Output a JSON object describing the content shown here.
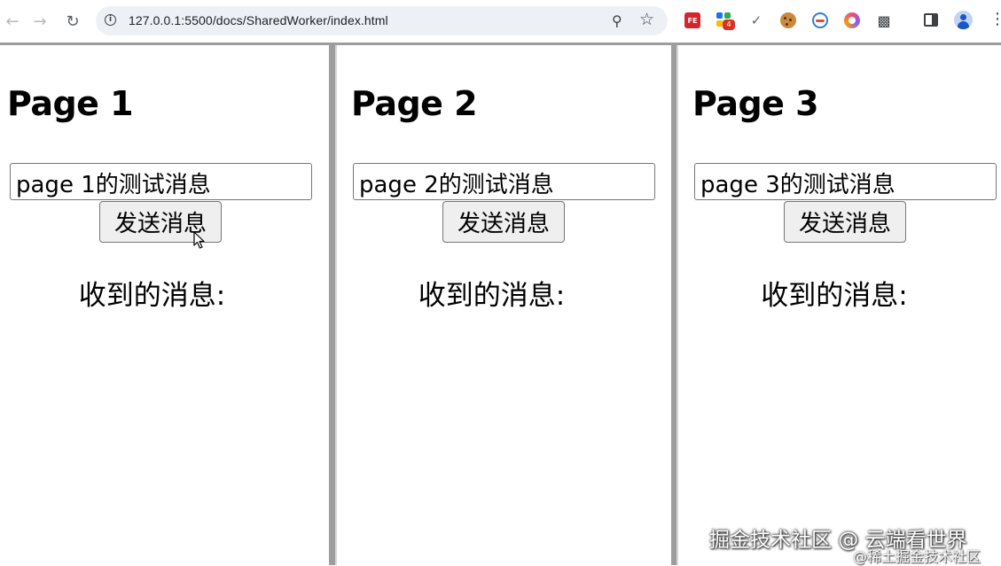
{
  "browser": {
    "url": "127.0.0.1:5500/docs/SharedWorker/index.html",
    "extension_fe_label": "FE",
    "extension_badge_count": "4",
    "icons": [
      "back-arrow-icon",
      "forward-arrow-icon",
      "reload-icon",
      "site-info-icon",
      "zoom-icon",
      "star-icon",
      "extension-fe-icon",
      "extension-grid-icon",
      "color-picker-icon",
      "cookie-icon",
      "globe-icon",
      "ring-icon",
      "puzzle-icon",
      "side-panel-icon",
      "profile-icon",
      "menu-icon"
    ]
  },
  "pages": [
    {
      "title": "Page 1",
      "input_value": "page 1的测试消息",
      "send_label": "发送消息",
      "received_label": "收到的消息:"
    },
    {
      "title": "Page 2",
      "input_value": "page 2的测试消息",
      "send_label": "发送消息",
      "received_label": "收到的消息:"
    },
    {
      "title": "Page 3",
      "input_value": "page 3的测试消息",
      "send_label": "发送消息",
      "received_label": "收到的消息:"
    }
  ],
  "watermark": {
    "main": "掘金技术社区 @ 云端看世界",
    "sub": "@稀土掘金技术社区"
  },
  "colors": {
    "frame_divider": "#9d9d9d",
    "omnibox_bg": "#edf0f4",
    "button_bg": "#efefef"
  }
}
